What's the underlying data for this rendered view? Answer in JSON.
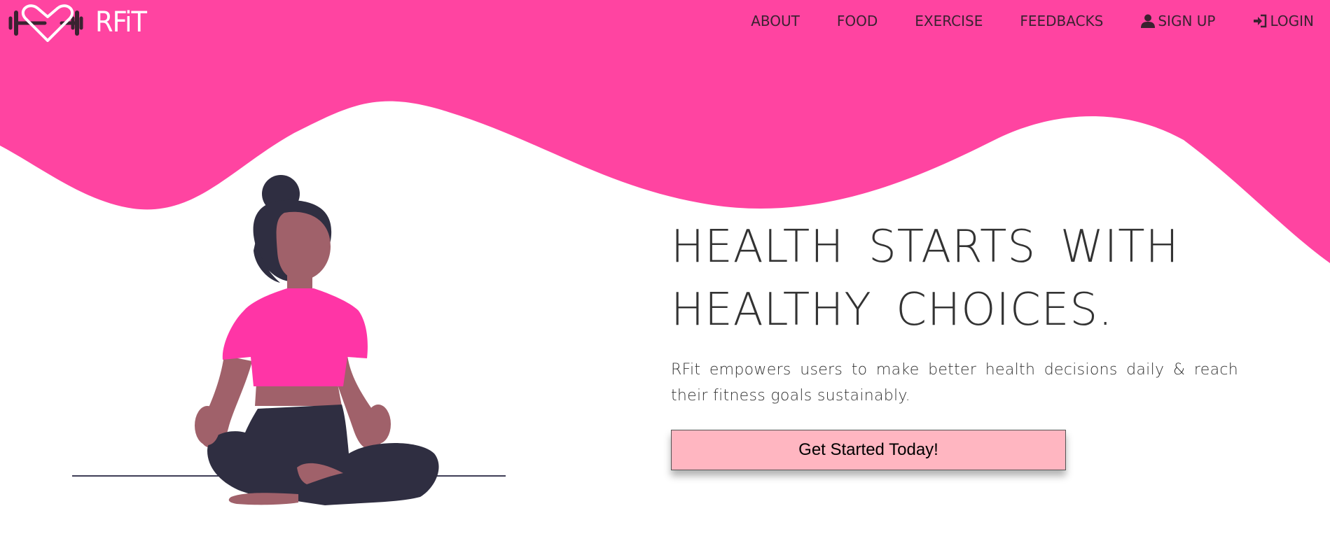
{
  "app": {
    "logo_text": "RFiT",
    "colors": {
      "brand": "#ff44a1",
      "cta": "#ffb6c1",
      "text": "#333333"
    }
  },
  "nav": {
    "items": [
      {
        "label": "ABOUT",
        "icon": null
      },
      {
        "label": "FOOD",
        "icon": null
      },
      {
        "label": "EXERCISE",
        "icon": null
      },
      {
        "label": "FEEDBACKS",
        "icon": null
      },
      {
        "label": "SIGN UP",
        "icon": "user-icon"
      },
      {
        "label": "LOGIN",
        "icon": "login-icon"
      }
    ]
  },
  "hero": {
    "title_line1": "HEALTH STARTS WITH",
    "title_line2": "HEALTHY CHOICES.",
    "subtitle": "RFit empowers users to make better health decisions daily & reach their fitness goals sustainably.",
    "cta_label": "Get Started Today!"
  },
  "illustration": {
    "icon": "meditating-woman-illustration"
  }
}
